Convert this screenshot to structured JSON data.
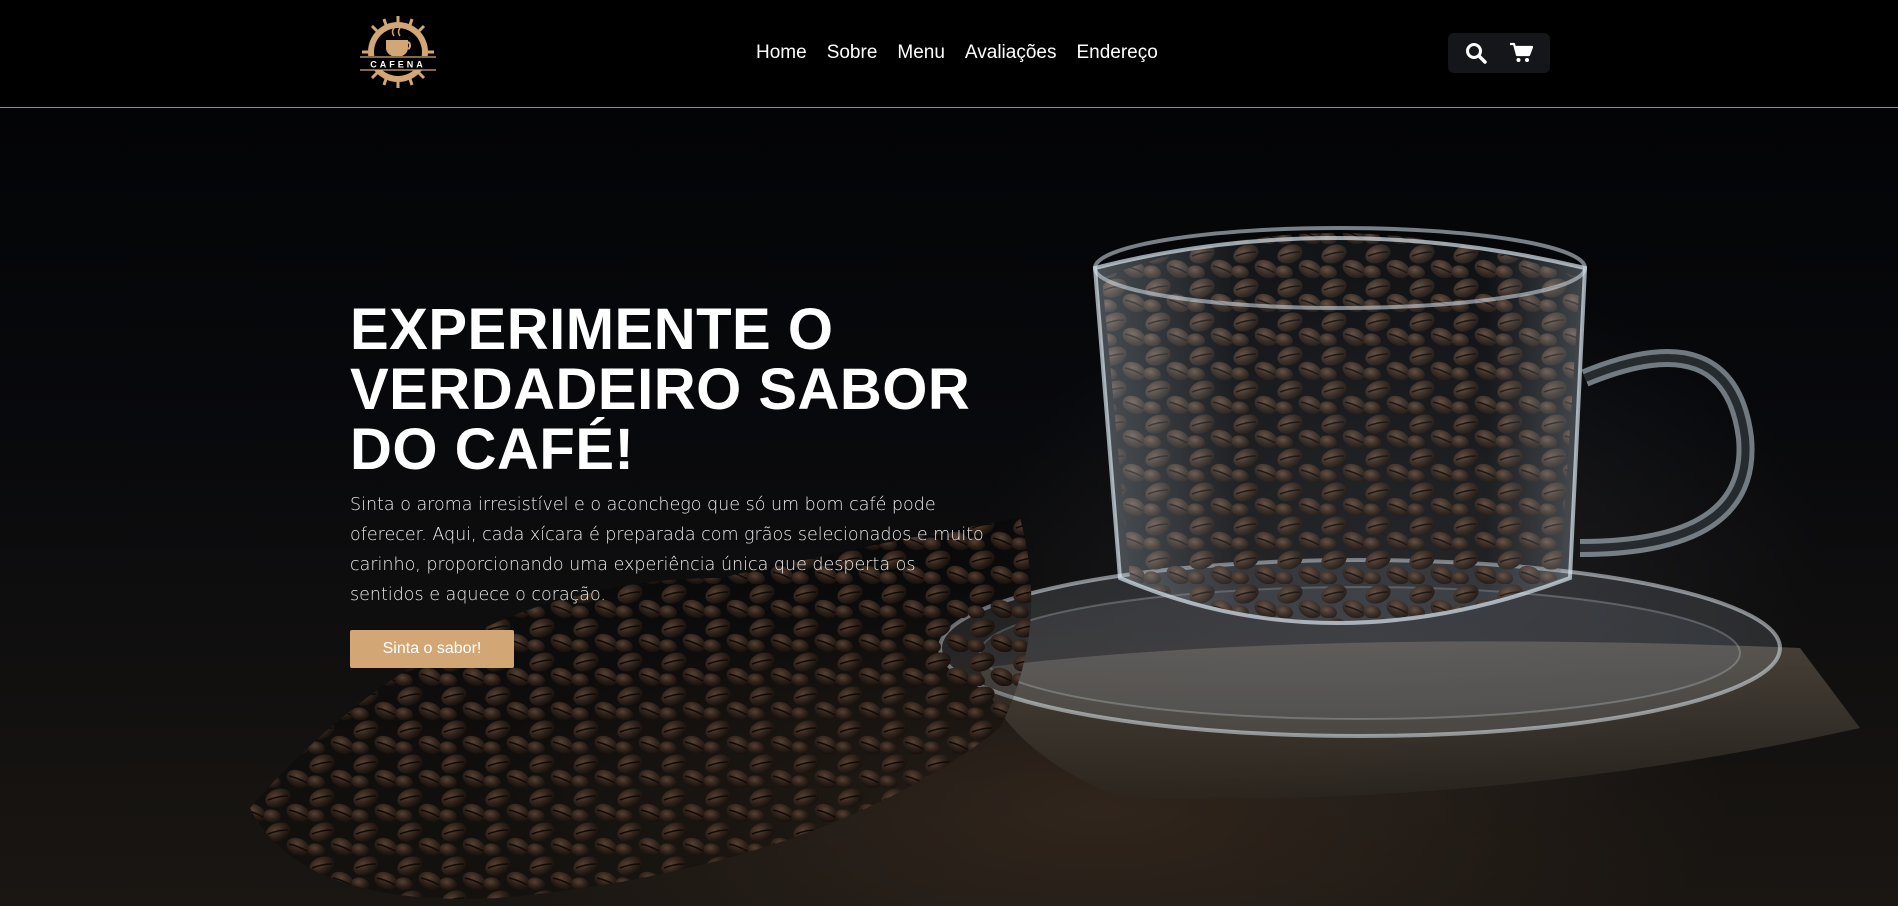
{
  "brand": {
    "logo_text": "CAFENA",
    "accent": "#d3a775"
  },
  "nav": {
    "items": [
      {
        "label": "Home"
      },
      {
        "label": "Sobre"
      },
      {
        "label": "Menu"
      },
      {
        "label": "Avaliações"
      },
      {
        "label": "Endereço"
      }
    ]
  },
  "header_icons": [
    "search-icon",
    "cart-icon"
  ],
  "hero": {
    "title": "EXPERIMENTE O VERDADEIRO SABOR DO CAFÉ!",
    "text": "Sinta o aroma irresistível e o aconchego que só um bom café pode oferecer. Aqui, cada xícara é preparada com grãos selecionados e muito carinho, proporcionando uma experiência única que desperta os sentidos e aquece o coração.",
    "button_label": "Sinta o sabor!"
  }
}
